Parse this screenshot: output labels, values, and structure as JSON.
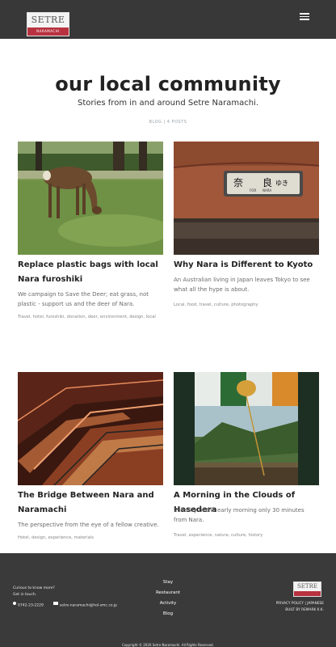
{
  "header": {
    "logo_text": "SETRE",
    "logo_sub": "NARAMACHI"
  },
  "intro": {
    "title": "our local community",
    "subtitle": "Stories from in and around Setre Naramachi.",
    "post_count": "BLOG | 4 POSTS"
  },
  "posts": [
    {
      "title": "Replace plastic bags with local Nara furoshiki",
      "excerpt": "We campaign to Save the Deer; eat grass, not plastic - support us and the deer of Nara.",
      "tags": "Travel, hotel, furoshiki, donation, deer, environment, design, local"
    },
    {
      "title": "Why Nara is Different to Kyoto",
      "excerpt": "An Australian living in Japan leaves Tokyo to see what all the hype is about.",
      "tags": "Local, food, travel, culture, photography"
    },
    {
      "title": "The Bridge Between Nara and Naramachi",
      "excerpt": "The perspective from the eye of a fellow creative.",
      "tags": "Hotel, design, experience, materials"
    },
    {
      "title": "A Morning in the Clouds of Hasedera",
      "excerpt": "Serenity of the early morning only 30 minutes from Nara.",
      "tags": "Travel, experience, nature, culture, history"
    }
  ],
  "footer": {
    "cta_line1": "Curious to know more?",
    "cta_line2": "Get in touch.",
    "phone": "0742-23-2229",
    "email": "setre-naramachi@hol-smc.co.jp",
    "nav": [
      "Stay",
      "Restaurant",
      "Activity",
      "Blog"
    ],
    "logo_text": "SETRE",
    "legal_line1": "PRIVACY POLICY | JAPANESE",
    "legal_line2": "BUILT BY REMARK K.K.",
    "copyright": "Copyright © 2020 Setre Naramachi. All Rights Reserved."
  },
  "colors": {
    "header_bg": "#383838",
    "footer_bg": "#3a3a3a",
    "brand_red": "#b8323f"
  }
}
